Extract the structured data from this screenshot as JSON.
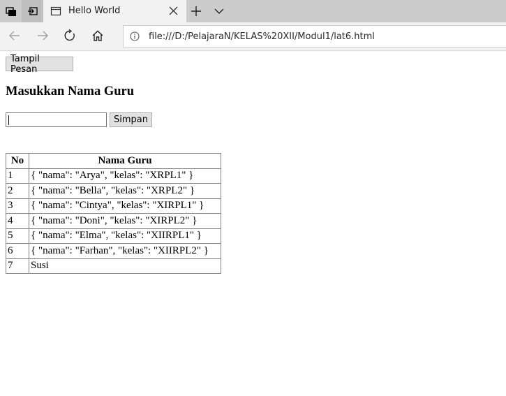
{
  "browser": {
    "tab_title": "Hello World",
    "url": "file:///D:/PelajaraN/KELAS%20XII/Modul1/lat6.html"
  },
  "page": {
    "tampil_button": "Tampil Pesan",
    "heading": "Masukkan Nama Guru",
    "input_value": "",
    "simpan_button": "Simpan",
    "table": {
      "headers": [
        "No",
        "Nama Guru"
      ],
      "rows": [
        [
          "1",
          "{ \"nama\": \"Arya\", \"kelas\": \"XRPL1\" }"
        ],
        [
          "2",
          "{ \"nama\": \"Bella\", \"kelas\": \"XRPL2\" }"
        ],
        [
          "3",
          "{ \"nama\": \"Cintya\", \"kelas\": \"XIRPL1\" }"
        ],
        [
          "4",
          "{ \"nama\": \"Doni\", \"kelas\": \"XIRPL2\" }"
        ],
        [
          "5",
          "{ \"nama\": \"Elma\", \"kelas\": \"XIIRPL1\" }"
        ],
        [
          "6",
          "{ \"nama\": \"Farhan\", \"kelas\": \"XIIRPL2\" }"
        ],
        [
          "7",
          "Susi"
        ]
      ]
    }
  }
}
